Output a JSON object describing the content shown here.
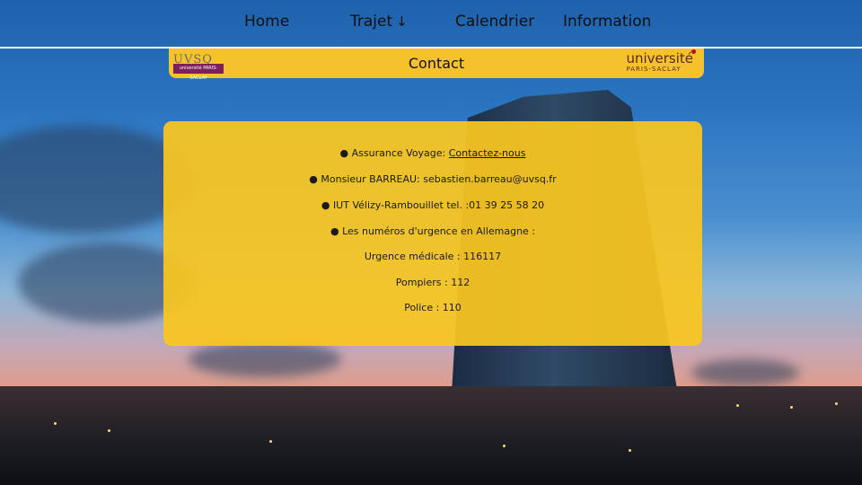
{
  "nav": {
    "items": [
      {
        "label": "Home"
      },
      {
        "label": "Trajet"
      },
      {
        "label": "Calendrier"
      },
      {
        "label": "Information"
      }
    ],
    "trajet_arrow": "↓"
  },
  "band": {
    "title": "Contact",
    "left_logo": {
      "text": "UVSQ",
      "sub": "université PARIS-SACLAY"
    },
    "right_logo": {
      "main": "université",
      "sub": "PARIS-SACLAY"
    }
  },
  "contact": {
    "bullet": "●",
    "assurance_prefix": "Assurance Voyage: ",
    "assurance_link": "Contactez-nous",
    "barreau": "Monsieur BARREAU: sebastien.barreau@uvsq.fr",
    "iut": "IUT Vélizy-Rambouillet tel. :01 39 25 58 20",
    "urgence_title": "Les numéros d'urgence en Allemagne :",
    "medicale": "Urgence médicale : 116117",
    "pompiers": "Pompiers : 112",
    "police": "Police : 110"
  },
  "colors": {
    "accent": "#f5c22e",
    "panel": "#fac620",
    "nav_line": "#ffffff"
  }
}
